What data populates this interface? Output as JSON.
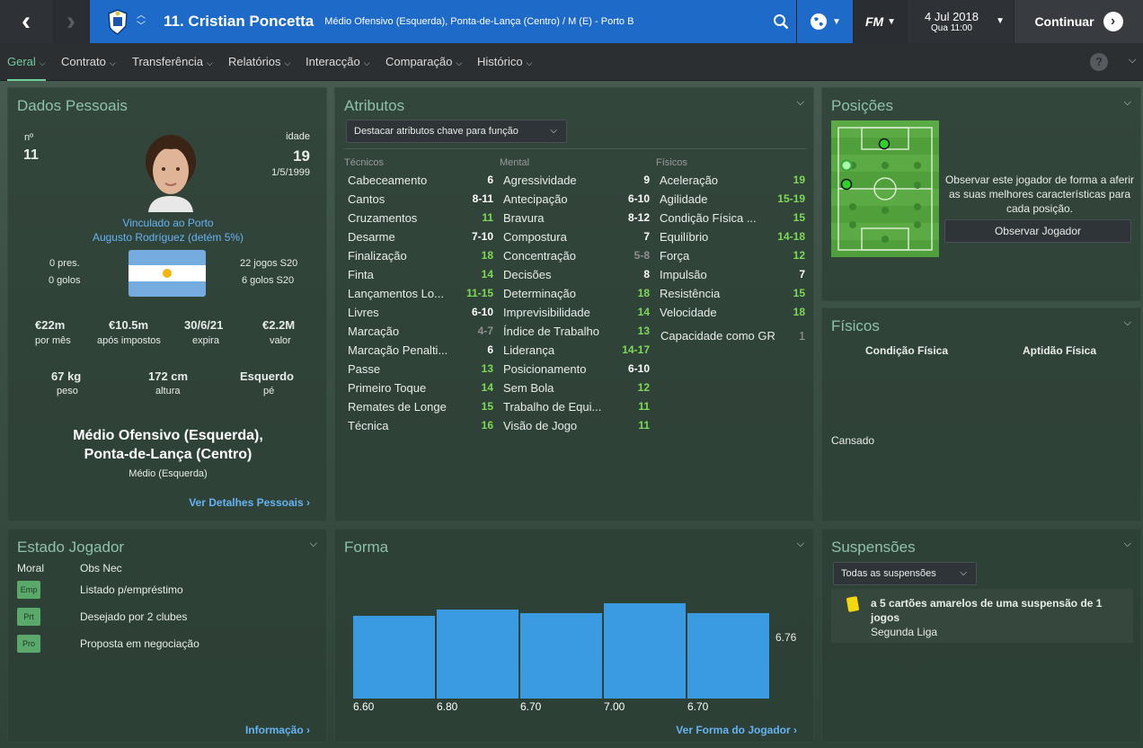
{
  "topbar": {
    "player_title": "11. Cristian Poncetta",
    "player_positions": "Médio Ofensivo (Esquerda), Ponta-de-Lança (Centro) / M (E) - Porto B",
    "date": "4 Jul 2018",
    "day_time": "Qua 11:00",
    "continue_label": "Continuar",
    "fm_label": "FM"
  },
  "nav": {
    "items": [
      "Geral",
      "Contrato",
      "Transferência",
      "Relatórios",
      "Interacção",
      "Comparação",
      "Histórico"
    ],
    "active": "Geral",
    "help": "?"
  },
  "personal": {
    "title": "Dados Pessoais",
    "number_label": "nº",
    "number": "11",
    "age_label": "idade",
    "age": "19",
    "dob": "1/5/1999",
    "contract_line1": "Vinculado ao Porto",
    "contract_line2": "Augusto Rodríguez (detém 5%)",
    "caps": "0 pres.",
    "goals": "0 golos",
    "u20_games": "22 jogos S20",
    "u20_goals": "6 golos S20",
    "wage": "€22m",
    "wage_label": "por mês",
    "after_tax": "€10.5m",
    "after_tax_label": "após impostos",
    "expiry": "30/6/21",
    "expiry_label": "expira",
    "value": "€2.2M",
    "value_label": "valor",
    "weight": "67 kg",
    "weight_label": "peso",
    "height": "172 cm",
    "height_label": "altura",
    "foot": "Esquerdo",
    "foot_label": "pé",
    "position_main1": "Médio Ofensivo (Esquerda),",
    "position_main2": "Ponta-de-Lança (Centro)",
    "position_secondary": "Médio (Esquerda)",
    "details_link": "Ver Detalhes Pessoais"
  },
  "attributes": {
    "title": "Atributos",
    "dropdown": "Destacar atributos chave para função",
    "technical_label": "Técnicos",
    "mental_label": "Mental",
    "physical_label": "Físicos",
    "technical": [
      {
        "name": "Cabeceamento",
        "value": "6",
        "hl": false
      },
      {
        "name": "Cantos",
        "value": "8-11",
        "hl": false
      },
      {
        "name": "Cruzamentos",
        "value": "11",
        "hl": true
      },
      {
        "name": "Desarme",
        "value": "7-10",
        "hl": false
      },
      {
        "name": "Finalização",
        "value": "18",
        "hl": true
      },
      {
        "name": "Finta",
        "value": "14",
        "hl": true
      },
      {
        "name": "Lançamentos Lo...",
        "value": "11-15",
        "hl": true
      },
      {
        "name": "Livres",
        "value": "6-10",
        "hl": false
      },
      {
        "name": "Marcação",
        "value": "4-7",
        "hl": false,
        "dim": true
      },
      {
        "name": "Marcação Penalti...",
        "value": "6",
        "hl": false
      },
      {
        "name": "Passe",
        "value": "13",
        "hl": true
      },
      {
        "name": "Primeiro Toque",
        "value": "14",
        "hl": true
      },
      {
        "name": "Remates de Longe",
        "value": "15",
        "hl": true
      },
      {
        "name": "Técnica",
        "value": "16",
        "hl": true
      }
    ],
    "mental": [
      {
        "name": "Agressividade",
        "value": "9",
        "hl": false
      },
      {
        "name": "Antecipação",
        "value": "6-10",
        "hl": false
      },
      {
        "name": "Bravura",
        "value": "8-12",
        "hl": false
      },
      {
        "name": "Compostura",
        "value": "7",
        "hl": false
      },
      {
        "name": "Concentração",
        "value": "5-8",
        "hl": false,
        "dim": true
      },
      {
        "name": "Decisões",
        "value": "8",
        "hl": false
      },
      {
        "name": "Determinação",
        "value": "18",
        "hl": true
      },
      {
        "name": "Imprevisibilidade",
        "value": "14",
        "hl": true
      },
      {
        "name": "Índice de Trabalho",
        "value": "13",
        "hl": true
      },
      {
        "name": "Liderança",
        "value": "14-17",
        "hl": true
      },
      {
        "name": "Posicionamento",
        "value": "6-10",
        "hl": false
      },
      {
        "name": "Sem Bola",
        "value": "12",
        "hl": true
      },
      {
        "name": "Trabalho de Equi...",
        "value": "11",
        "hl": true
      },
      {
        "name": "Visão de Jogo",
        "value": "11",
        "hl": true
      }
    ],
    "physical": [
      {
        "name": "Aceleração",
        "value": "19",
        "hl": true
      },
      {
        "name": "Agilidade",
        "value": "15-19",
        "hl": true
      },
      {
        "name": "Condição Física ...",
        "value": "15",
        "hl": true
      },
      {
        "name": "Equilíbrio",
        "value": "14-18",
        "hl": true
      },
      {
        "name": "Força",
        "value": "12",
        "hl": true
      },
      {
        "name": "Impulsão",
        "value": "7",
        "hl": false
      },
      {
        "name": "Resistência",
        "value": "15",
        "hl": true
      },
      {
        "name": "Velocidade",
        "value": "18",
        "hl": true
      }
    ],
    "gk_label": "Capacidade como GR",
    "gk_value": "1"
  },
  "positions": {
    "title": "Posições",
    "observe_text": "Observar este jogador de forma a aferir as suas melhores características para cada posição.",
    "observe_button": "Observar Jogador"
  },
  "physicals": {
    "title": "Físicos",
    "condition_label": "Condição Física",
    "fitness_label": "Aptidão Física",
    "status": "Cansado"
  },
  "player_status": {
    "title": "Estado Jogador",
    "morale_label": "Moral",
    "notes_label": "Obs Nec",
    "rows": [
      {
        "tag": "Emp",
        "text": "Listado p/empréstimo"
      },
      {
        "tag": "Prt",
        "text": "Desejado por 2 clubes"
      },
      {
        "tag": "Pro",
        "text": "Proposta em negociação"
      }
    ],
    "link": "Informação"
  },
  "form": {
    "title": "Forma",
    "average": "6.76",
    "link": "Ver Forma do Jogador"
  },
  "chart_data": {
    "type": "bar",
    "categories": [
      "6.60",
      "6.80",
      "6.70",
      "7.00",
      "6.70"
    ],
    "values": [
      6.6,
      6.8,
      6.7,
      7.0,
      6.7
    ],
    "title": "",
    "average": 6.76
  },
  "suspensions": {
    "title": "Suspensões",
    "dropdown": "Todas as suspensões",
    "text": "a 5 cartões amarelos de uma suspensão de 1 jogos",
    "competition": "Segunda Liga"
  },
  "colors": {
    "accent": "#1e6ac9",
    "highlight": "#7fd857",
    "link": "#66b3f2",
    "bar": "#3a9be3"
  }
}
